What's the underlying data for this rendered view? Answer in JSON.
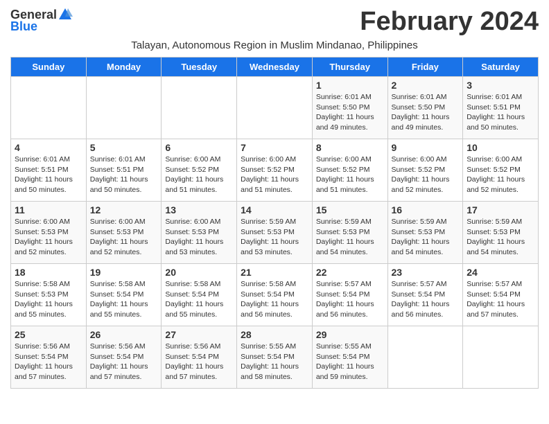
{
  "logo": {
    "text_general": "General",
    "text_blue": "Blue"
  },
  "title": "February 2024",
  "location": "Talayan, Autonomous Region in Muslim Mindanao, Philippines",
  "days_of_week": [
    "Sunday",
    "Monday",
    "Tuesday",
    "Wednesday",
    "Thursday",
    "Friday",
    "Saturday"
  ],
  "weeks": [
    [
      {
        "day": "",
        "detail": ""
      },
      {
        "day": "",
        "detail": ""
      },
      {
        "day": "",
        "detail": ""
      },
      {
        "day": "",
        "detail": ""
      },
      {
        "day": "1",
        "detail": "Sunrise: 6:01 AM\nSunset: 5:50 PM\nDaylight: 11 hours\nand 49 minutes."
      },
      {
        "day": "2",
        "detail": "Sunrise: 6:01 AM\nSunset: 5:50 PM\nDaylight: 11 hours\nand 49 minutes."
      },
      {
        "day": "3",
        "detail": "Sunrise: 6:01 AM\nSunset: 5:51 PM\nDaylight: 11 hours\nand 50 minutes."
      }
    ],
    [
      {
        "day": "4",
        "detail": "Sunrise: 6:01 AM\nSunset: 5:51 PM\nDaylight: 11 hours\nand 50 minutes."
      },
      {
        "day": "5",
        "detail": "Sunrise: 6:01 AM\nSunset: 5:51 PM\nDaylight: 11 hours\nand 50 minutes."
      },
      {
        "day": "6",
        "detail": "Sunrise: 6:00 AM\nSunset: 5:52 PM\nDaylight: 11 hours\nand 51 minutes."
      },
      {
        "day": "7",
        "detail": "Sunrise: 6:00 AM\nSunset: 5:52 PM\nDaylight: 11 hours\nand 51 minutes."
      },
      {
        "day": "8",
        "detail": "Sunrise: 6:00 AM\nSunset: 5:52 PM\nDaylight: 11 hours\nand 51 minutes."
      },
      {
        "day": "9",
        "detail": "Sunrise: 6:00 AM\nSunset: 5:52 PM\nDaylight: 11 hours\nand 52 minutes."
      },
      {
        "day": "10",
        "detail": "Sunrise: 6:00 AM\nSunset: 5:52 PM\nDaylight: 11 hours\nand 52 minutes."
      }
    ],
    [
      {
        "day": "11",
        "detail": "Sunrise: 6:00 AM\nSunset: 5:53 PM\nDaylight: 11 hours\nand 52 minutes."
      },
      {
        "day": "12",
        "detail": "Sunrise: 6:00 AM\nSunset: 5:53 PM\nDaylight: 11 hours\nand 52 minutes."
      },
      {
        "day": "13",
        "detail": "Sunrise: 6:00 AM\nSunset: 5:53 PM\nDaylight: 11 hours\nand 53 minutes."
      },
      {
        "day": "14",
        "detail": "Sunrise: 5:59 AM\nSunset: 5:53 PM\nDaylight: 11 hours\nand 53 minutes."
      },
      {
        "day": "15",
        "detail": "Sunrise: 5:59 AM\nSunset: 5:53 PM\nDaylight: 11 hours\nand 54 minutes."
      },
      {
        "day": "16",
        "detail": "Sunrise: 5:59 AM\nSunset: 5:53 PM\nDaylight: 11 hours\nand 54 minutes."
      },
      {
        "day": "17",
        "detail": "Sunrise: 5:59 AM\nSunset: 5:53 PM\nDaylight: 11 hours\nand 54 minutes."
      }
    ],
    [
      {
        "day": "18",
        "detail": "Sunrise: 5:58 AM\nSunset: 5:53 PM\nDaylight: 11 hours\nand 55 minutes."
      },
      {
        "day": "19",
        "detail": "Sunrise: 5:58 AM\nSunset: 5:54 PM\nDaylight: 11 hours\nand 55 minutes."
      },
      {
        "day": "20",
        "detail": "Sunrise: 5:58 AM\nSunset: 5:54 PM\nDaylight: 11 hours\nand 55 minutes."
      },
      {
        "day": "21",
        "detail": "Sunrise: 5:58 AM\nSunset: 5:54 PM\nDaylight: 11 hours\nand 56 minutes."
      },
      {
        "day": "22",
        "detail": "Sunrise: 5:57 AM\nSunset: 5:54 PM\nDaylight: 11 hours\nand 56 minutes."
      },
      {
        "day": "23",
        "detail": "Sunrise: 5:57 AM\nSunset: 5:54 PM\nDaylight: 11 hours\nand 56 minutes."
      },
      {
        "day": "24",
        "detail": "Sunrise: 5:57 AM\nSunset: 5:54 PM\nDaylight: 11 hours\nand 57 minutes."
      }
    ],
    [
      {
        "day": "25",
        "detail": "Sunrise: 5:56 AM\nSunset: 5:54 PM\nDaylight: 11 hours\nand 57 minutes."
      },
      {
        "day": "26",
        "detail": "Sunrise: 5:56 AM\nSunset: 5:54 PM\nDaylight: 11 hours\nand 57 minutes."
      },
      {
        "day": "27",
        "detail": "Sunrise: 5:56 AM\nSunset: 5:54 PM\nDaylight: 11 hours\nand 57 minutes."
      },
      {
        "day": "28",
        "detail": "Sunrise: 5:55 AM\nSunset: 5:54 PM\nDaylight: 11 hours\nand 58 minutes."
      },
      {
        "day": "29",
        "detail": "Sunrise: 5:55 AM\nSunset: 5:54 PM\nDaylight: 11 hours\nand 59 minutes."
      },
      {
        "day": "",
        "detail": ""
      },
      {
        "day": "",
        "detail": ""
      }
    ]
  ]
}
